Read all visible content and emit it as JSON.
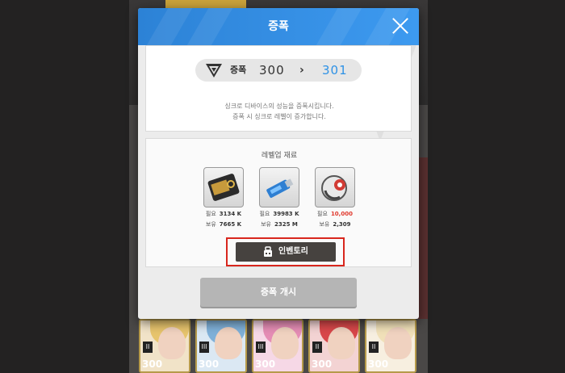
{
  "dialog": {
    "title": "증폭",
    "amplify": {
      "label": "증폭",
      "from": "300",
      "arrow": "›",
      "to": "301"
    },
    "description": [
      "싱크로 디바이스의 성능을 증폭시킵니다.",
      "증폭 시 싱크로 레벨이 증가합니다."
    ],
    "materials": {
      "title": "레벨업 재료",
      "items": [
        {
          "icon": "chip-card-icon",
          "required_label": "필요",
          "required": "3134 K",
          "owned_label": "보유",
          "owned": "7665 K",
          "required_color": "#333333"
        },
        {
          "icon": "usb-drive-icon",
          "required_label": "필요",
          "required": "39983 K",
          "owned_label": "보유",
          "owned": "2325 M",
          "required_color": "#333333"
        },
        {
          "icon": "core-orb-icon",
          "required_label": "필요",
          "required": "10,000",
          "owned_label": "보유",
          "owned": "2,309",
          "required_color": "#e0392d"
        }
      ]
    },
    "inventory_label": "인벤토리",
    "start_label": "증폭 개시"
  },
  "background_cards": [
    {
      "rank": "II",
      "level": "300",
      "hair": "#e7c46d"
    },
    {
      "rank": "III",
      "level": "300",
      "hair": "#7fb0d8"
    },
    {
      "rank": "III",
      "level": "300",
      "hair": "#e58db5"
    },
    {
      "rank": "II",
      "level": "300",
      "hair": "#d8474a"
    },
    {
      "rank": "II",
      "level": "300",
      "hair": "#f0e0b8"
    }
  ],
  "colors": {
    "header": "#2c82d6",
    "accent": "#2e92e6",
    "highlight_border": "#d8261d",
    "insufficient": "#e0392d"
  }
}
